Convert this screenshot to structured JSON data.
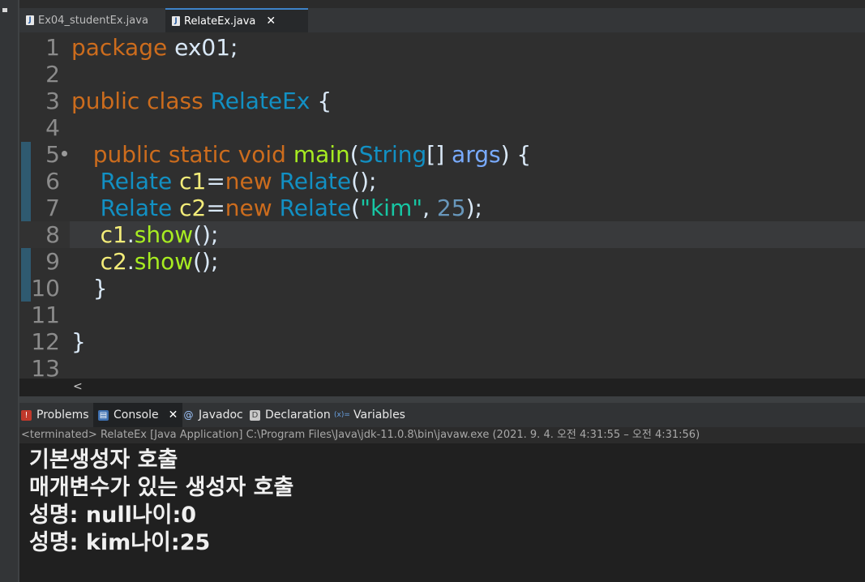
{
  "editor_tabs": [
    {
      "label": "Ex04_studentEx.java",
      "active": false
    },
    {
      "label": "RelateEx.java",
      "active": true,
      "close": "✕"
    }
  ],
  "code_lines": [
    {
      "num": "1"
    },
    {
      "num": "2"
    },
    {
      "num": "3"
    },
    {
      "num": "4"
    },
    {
      "num": "5"
    },
    {
      "num": "6"
    },
    {
      "num": "7"
    },
    {
      "num": "8"
    },
    {
      "num": "9"
    },
    {
      "num": "10"
    },
    {
      "num": "11"
    },
    {
      "num": "12"
    },
    {
      "num": "13"
    }
  ],
  "code": {
    "l1": {
      "kw": "package",
      "rest": " ex01;"
    },
    "l3": {
      "kw1": "public",
      "kw2": "class",
      "cls": "RelateEx",
      "brace": "{"
    },
    "l5": {
      "kw1": "public",
      "kw2": "static",
      "kw3": "void",
      "meth": "main",
      "p1": "(",
      "cls": "String",
      "arr": "[] ",
      "par": "args",
      "p2": ") {"
    },
    "l6": {
      "cls": "Relate",
      "var": "c1",
      "eq": "=",
      "kw": "new",
      "cls2": "Relate",
      "end": "();"
    },
    "l7": {
      "cls": "Relate",
      "var": "c2",
      "eq": "=",
      "kw": "new",
      "cls2": "Relate",
      "p1": "(",
      "str": "\"kim\"",
      "comma": ", ",
      "num": "25",
      "end": ");"
    },
    "l8": {
      "var": "c1",
      "dot": ".",
      "meth": "show",
      "end": "();"
    },
    "l9": {
      "var": "c2",
      "dot": ".",
      "meth": "show",
      "end": "();"
    },
    "l10": {
      "brace": "}"
    },
    "l12": {
      "brace": "}"
    }
  },
  "scroll_arrow": "<",
  "panel_tabs": {
    "problems": "Problems",
    "console": "Console",
    "javadoc": "Javadoc",
    "declaration": "Declaration",
    "variables": "Variables",
    "close": "✕"
  },
  "console_status": "<terminated> RelateEx [Java Application] C:\\Program Files\\Java\\jdk-11.0.8\\bin\\javaw.exe  (2021. 9. 4. 오전 4:31:55 – 오전 4:31:56)",
  "console_output": [
    "기본생성자 호출",
    "매개변수가 있는 생성자 호출",
    "성명: null나이:0",
    "성명: kim나이:25"
  ],
  "icons": {
    "java-file-icon": "J",
    "problems-icon": "!",
    "console-icon": "▤",
    "javadoc-icon": "@",
    "declaration-icon": "D",
    "variables-icon": "(x)="
  },
  "colors": {
    "keyword": "#cc6c1d",
    "class": "#1290c3",
    "variable": "#f3ec79",
    "method": "#a7ec21",
    "parameter": "#79abff",
    "string": "#17c6a3",
    "number": "#6897bb",
    "active_tab_accent": "#3e83c8"
  }
}
